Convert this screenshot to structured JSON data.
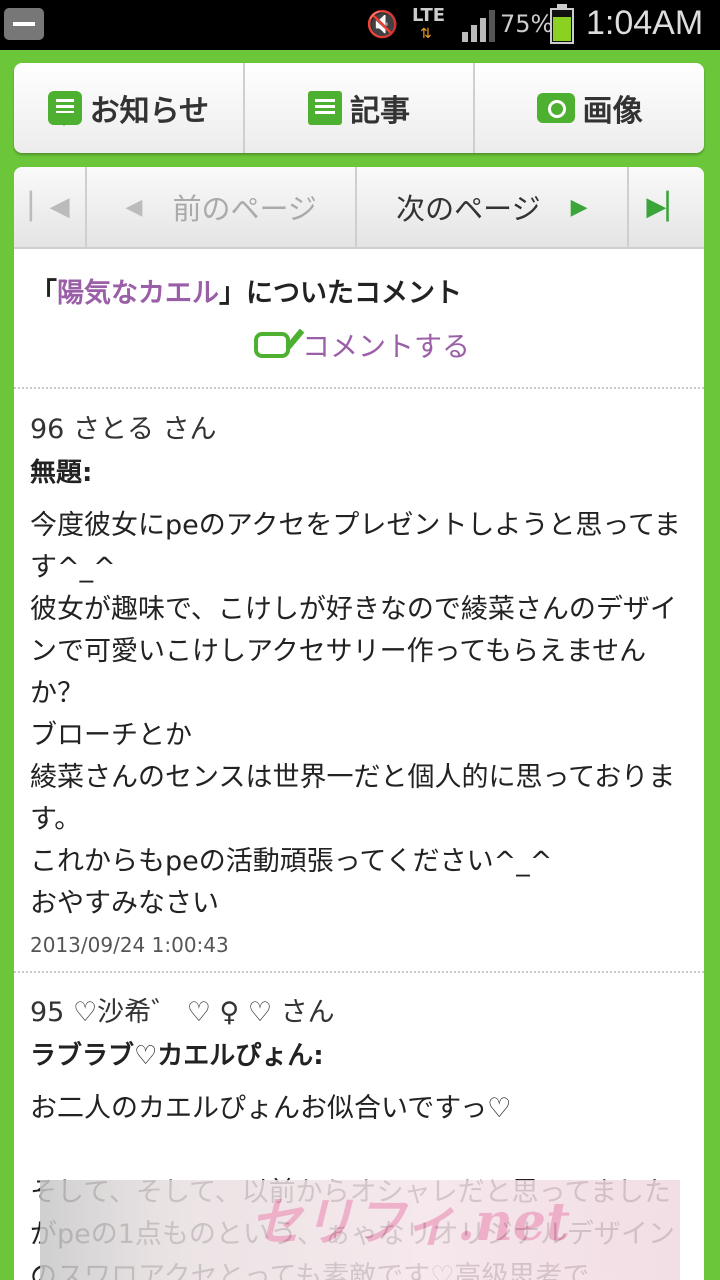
{
  "status_bar": {
    "network": "LTE",
    "battery_percent": "75%",
    "battery_level": 0.75,
    "time": "1:04AM"
  },
  "top_nav": {
    "notice": "お知らせ",
    "article": "記事",
    "image": "画像"
  },
  "pager": {
    "first_symbol": "⏮",
    "prev_label": "前のページ",
    "next_label": "次のページ",
    "last_symbol": "⏭"
  },
  "heading": {
    "open_bracket": "「",
    "highlight": "陽気なカエル",
    "rest": "」についたコメント"
  },
  "comment_link": "コメントする",
  "comments": [
    {
      "author": "96 さとる さん",
      "title": "無題:",
      "body": "今度彼女にpeのアクセをプレゼントしようと思ってます^_^\n彼女が趣味で、こけしが好きなので綾菜さんのデザインで可愛いこけしアクセサリー作ってもらえませんか？\nブローチとか\n綾菜さんのセンスは世界一だと個人的に思っております。\nこれからもpeの活動頑張ってください^_^\nおやすみなさい",
      "date": "2013/09/24 1:00:43"
    },
    {
      "author": "95 ♡沙希゛ ♡ ♀ ♡ さん",
      "title": "ラブラブ♡カエルぴょん:",
      "body": "お二人のカエルぴょんお似合いですっ♡\n\nそして、そして、以前からオシャレだと思ってましたがpeの1点ものという、ぁゃなリオリジナルデザインのスワロアクセとっても素敵です♡高級思考で"
    }
  ],
  "ad": {
    "title": "セリフィ.net"
  }
}
